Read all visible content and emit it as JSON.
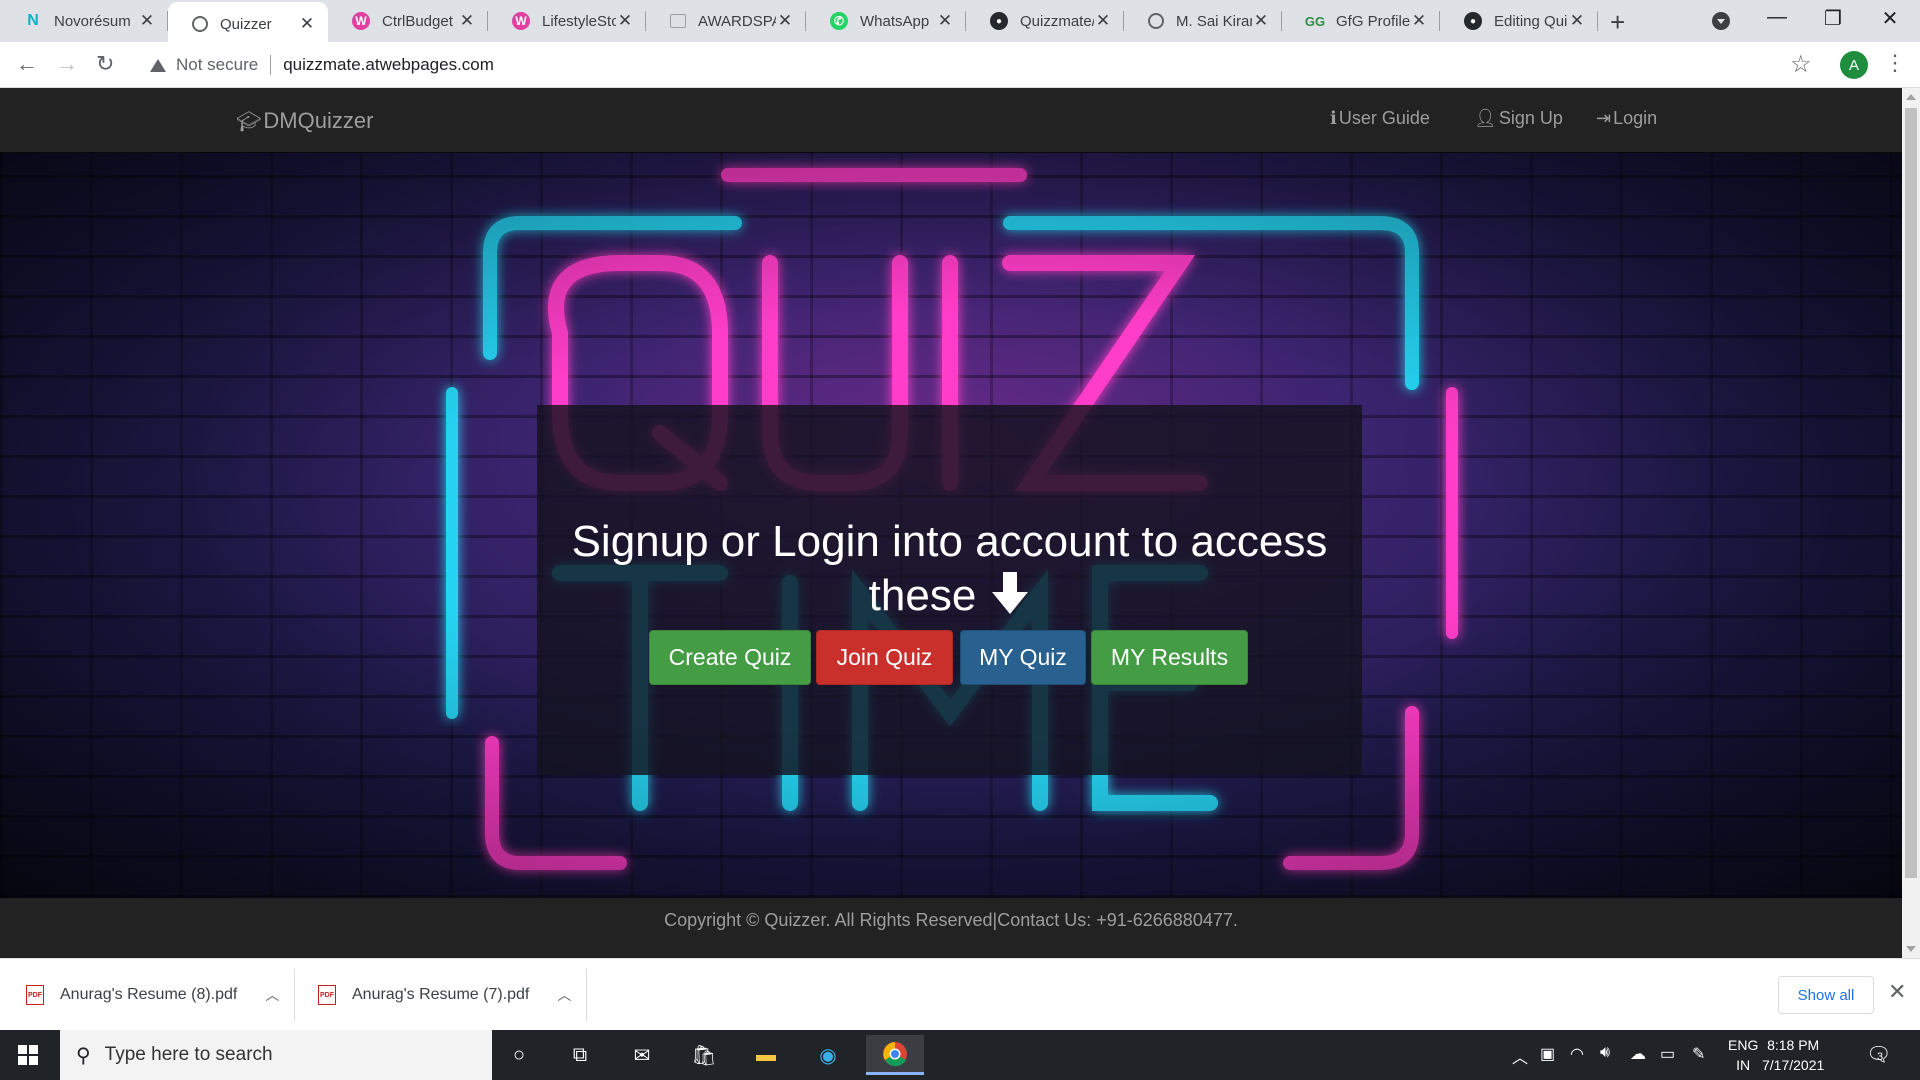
{
  "browser": {
    "tabs": [
      {
        "title": "Novorésum",
        "icon": "novoresume-icon",
        "color": "#0fb3c9"
      },
      {
        "title": "Quizzer",
        "icon": "globe-icon",
        "color": "#5f6368",
        "active": true
      },
      {
        "title": "CtrlBudget",
        "icon": "webhost-icon",
        "color": "#e040a0"
      },
      {
        "title": "LifestyleSto",
        "icon": "webhost-icon",
        "color": "#e040a0"
      },
      {
        "title": "AWARDSPA",
        "icon": "page-icon",
        "color": "#5f6368"
      },
      {
        "title": "WhatsApp",
        "icon": "whatsapp-icon",
        "color": "#25d366"
      },
      {
        "title": "Quizzmate/",
        "icon": "github-icon",
        "color": "#24292e"
      },
      {
        "title": "M. Sai Kiran",
        "icon": "globe-icon",
        "color": "#5f6368"
      },
      {
        "title": "GfG Profile",
        "icon": "gfg-icon",
        "color": "#2f8d46"
      },
      {
        "title": "Editing Qui",
        "icon": "github-icon",
        "color": "#24292e"
      }
    ],
    "security_label": "Not secure",
    "url": "quizzmate.atwebpages.com",
    "profile_initial": "A"
  },
  "site": {
    "brand": "DMQuizzer",
    "nav": {
      "user_guide": "User Guide",
      "sign_up": "Sign Up",
      "login": "Login"
    },
    "hero": {
      "headline": "Signup or Login into account to access these",
      "buttons": [
        {
          "label": "Create Quiz",
          "color": "#449d44"
        },
        {
          "label": "Join Quiz",
          "color": "#c9302c"
        },
        {
          "label": "MY Quiz",
          "color": "#286090"
        },
        {
          "label": "MY Results",
          "color": "#449d44"
        }
      ]
    },
    "footer": "Copyright © Quizzer. All Rights Reserved|Contact Us: +91-6266880477."
  },
  "downloads": {
    "items": [
      {
        "name": "Anurag's Resume (8).pdf"
      },
      {
        "name": "Anurag's Resume (7).pdf"
      }
    ],
    "show_all": "Show all"
  },
  "taskbar": {
    "search_placeholder": "Type here to search",
    "lang_line1": "ENG",
    "lang_line2": "IN",
    "time": "8:18 PM",
    "date": "7/17/2021",
    "notification_count": "3"
  }
}
